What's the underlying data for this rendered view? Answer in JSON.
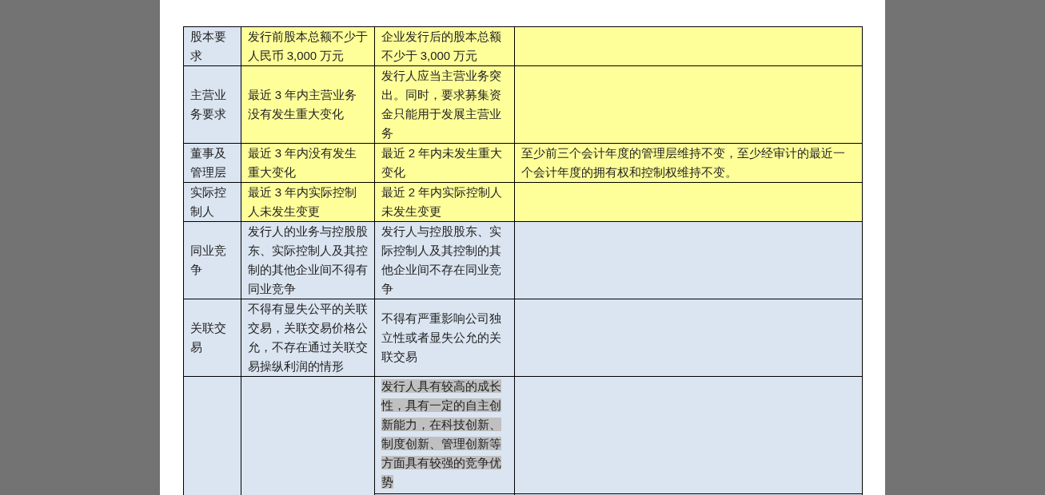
{
  "table": {
    "rows": [
      {
        "column_1": "股本要求",
        "column_2": "发行前股本总额不少于人民币 3,000 万元",
        "column_3": "企业发行后的股本总额不少于 3,000 万元",
        "color": "#ffff99",
        "highlighted": false
      },
      {
        "column_1": "主营业务要求",
        "column_2": "最近 3 年内主营业务没有发生重大变化",
        "column_3": "发行人应当主营业务突出。同时，要求募集资金只能用于发展主营业务",
        "color": "#ffff99",
        "highlighted": false
      },
      {
        "column_1": "董事及管理层",
        "column_2": "最近 3 年内没有发生重大变化",
        "column_3": "最近 2 年内未发生重大变化",
        "column_4": "至少前三个会计年度的管理层维持不变，至少经审计的最近一个会计年度的拥有权和控制权维持不变。",
        "color": "#ffff99",
        "highlighted": false
      },
      {
        "column_1": "实际控制人",
        "column_2": "最近 3 年内实际控制人未发生变更",
        "column_3": "最近 2 年内实际控制人未发生变更",
        "color": "#ffff99",
        "highlighted": false
      },
      {
        "column_1": "同业竞争",
        "column_2": "发行人的业务与控股股东、实际控制人及其控制的其他企业间不得有同业竞争",
        "column_3": "发行人与控股股东、实际控制人及其控制的其他企业间不存在同业竞争",
        "color": "#dbe5f1",
        "highlighted": false
      },
      {
        "column_1": "关联交易",
        "column_2": "不得有显失公平的关联交易，关联交易价格公允，不存在通过关联交易操纵利润的情形",
        "column_3": "不得有严重影响公司独立性或者显失公允的关联交易",
        "color": "#dbe5f1",
        "highlighted": false
      },
      {
        "column_3": "发行人具有较高的成长性，具有一定的自主创新能力，在科技创新、制度创新、管理创新等方面具有较强的竞争优势",
        "color": "#dbe5f1",
        "highlighted": true
      }
    ]
  }
}
